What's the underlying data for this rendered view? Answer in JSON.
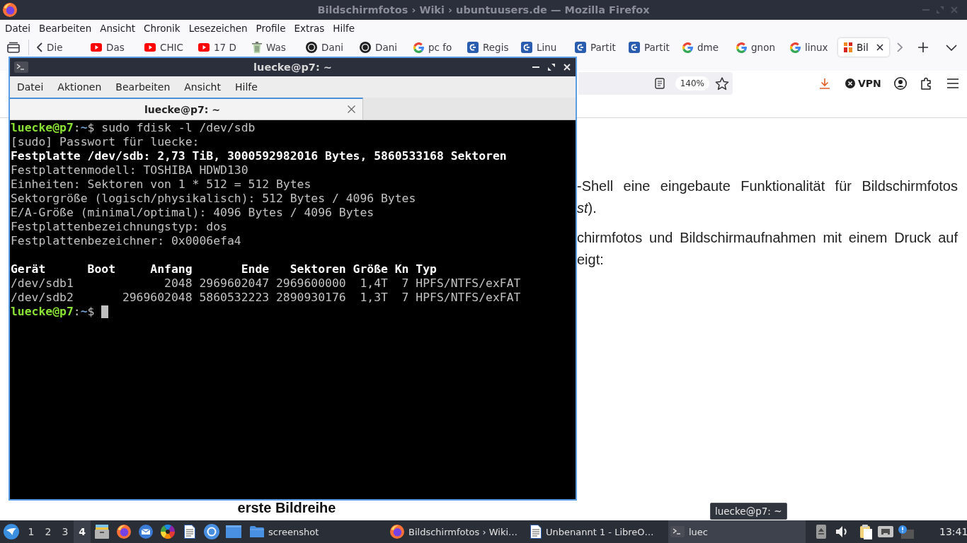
{
  "browser": {
    "title": "Bildschirmfotos › Wiki › ubuntuusers.de — Mozilla Firefox",
    "menu": [
      "Datei",
      "Bearbeiten",
      "Ansicht",
      "Chronik",
      "Lesezeichen",
      "Profile",
      "Extras",
      "Hilfe"
    ],
    "tabs": [
      {
        "label": "Die",
        "kind": "arrow",
        "selected": false
      },
      {
        "label": "Das",
        "kind": "video",
        "selected": false
      },
      {
        "label": "CHIC",
        "kind": "video",
        "selected": false
      },
      {
        "label": "17 D",
        "kind": "video",
        "selected": false
      },
      {
        "label": "Was",
        "kind": "bin",
        "selected": false
      },
      {
        "label": "Dani",
        "kind": "disc",
        "selected": false
      },
      {
        "label": "Dani",
        "kind": "disc",
        "selected": false
      },
      {
        "label": "pc fo",
        "kind": "search",
        "selected": false
      },
      {
        "label": "Regis",
        "kind": "tile",
        "selected": false
      },
      {
        "label": "Linu",
        "kind": "tile",
        "selected": false
      },
      {
        "label": "Partit",
        "kind": "tile",
        "selected": false
      },
      {
        "label": "Partit",
        "kind": "tile",
        "selected": false
      },
      {
        "label": "dme",
        "kind": "search",
        "selected": false
      },
      {
        "label": "gnon",
        "kind": "search",
        "selected": false
      },
      {
        "label": "linux",
        "kind": "search",
        "selected": false
      },
      {
        "label": "Bil",
        "kind": "logo",
        "selected": true
      }
    ],
    "zoom": "140%",
    "vpn": "VPN"
  },
  "page": {
    "paragraphs": [
      {
        "lines": [
          "-Shell eine eingebaute Funktionalität für Bildschirmfotos",
          "*st*)."
        ]
      },
      {
        "lines": [
          "chirmfotos und Bildschirmaufnahmen mit einem Druck auf",
          "eigt:"
        ]
      }
    ],
    "caption": "erste Bildreihe"
  },
  "terminal": {
    "title": "luecke@p7: ~",
    "menu": [
      "Datei",
      "Aktionen",
      "Bearbeiten",
      "Ansicht",
      "Hilfe"
    ],
    "tabs": [
      {
        "label": "luecke@p7: ~",
        "selected": true
      }
    ],
    "blocks": [
      {
        "lines": [
          {
            "segments": [
              {
                "text": "luecke@p7",
                "kind": "user"
              },
              {
                "text": ":",
                "kind": "plain"
              },
              {
                "text": "~",
                "kind": "path"
              },
              {
                "text": "$ sudo fdisk -l /dev/sdb",
                "kind": "plain"
              }
            ],
            "cursor": false
          },
          {
            "segments": [
              {
                "text": "[sudo] Passwort für luecke:",
                "kind": "plain"
              }
            ],
            "cursor": false
          },
          {
            "segments": [
              {
                "text": "Festplatte /dev/sdb: 2,73 TiB, 3000592982016 Bytes, 5860533168 Sektoren",
                "kind": "bold"
              }
            ],
            "cursor": false
          },
          {
            "segments": [
              {
                "text": "Festplattenmodell: TOSHIBA HDWD130",
                "kind": "plain"
              }
            ],
            "cursor": false
          },
          {
            "segments": [
              {
                "text": "Einheiten: Sektoren von 1 * 512 = 512 Bytes",
                "kind": "plain"
              }
            ],
            "cursor": false
          },
          {
            "segments": [
              {
                "text": "Sektorgröße (logisch/physikalisch): 512 Bytes / 4096 Bytes",
                "kind": "plain"
              }
            ],
            "cursor": false
          },
          {
            "segments": [
              {
                "text": "E/A-Größe (minimal/optimal): 4096 Bytes / 4096 Bytes",
                "kind": "plain"
              }
            ],
            "cursor": false
          },
          {
            "segments": [
              {
                "text": "Festplattenbezeichnungstyp: dos",
                "kind": "plain"
              }
            ],
            "cursor": false
          },
          {
            "segments": [
              {
                "text": "Festplattenbezeichner: 0x0006efa4",
                "kind": "plain"
              }
            ],
            "cursor": false
          }
        ]
      },
      {
        "lines": [
          {
            "segments": [
              {
                "text": "Gerät      Boot     Anfang       Ende   Sektoren Größe Kn Typ",
                "kind": "bold"
              }
            ],
            "cursor": false
          },
          {
            "segments": [
              {
                "text": "/dev/sdb1             2048 2969602047 2969600000  1,4T  7 HPFS/NTFS/exFAT",
                "kind": "plain"
              }
            ],
            "cursor": false
          },
          {
            "segments": [
              {
                "text": "/dev/sdb2       2969602048 5860532223 2890930176  1,3T  7 HPFS/NTFS/exFAT",
                "kind": "plain"
              }
            ],
            "cursor": false
          },
          {
            "segments": [
              {
                "text": "luecke@p7",
                "kind": "user"
              },
              {
                "text": ":",
                "kind": "plain"
              },
              {
                "text": "~",
                "kind": "path"
              },
              {
                "text": "$",
                "kind": "plain"
              }
            ],
            "cursor": true
          }
        ]
      }
    ]
  },
  "taskbar": {
    "workspaces": [
      {
        "label": "1",
        "selected": false
      },
      {
        "label": "2",
        "selected": false
      },
      {
        "label": "3",
        "selected": false
      },
      {
        "label": "4",
        "selected": true
      }
    ],
    "windows": [
      {
        "label": "screenshot",
        "kind": "folder",
        "selected": false
      },
      {
        "label": "Bildschirmfotos › Wiki…",
        "kind": "browser",
        "selected": false
      },
      {
        "label": "Unbenannt 1 - LibreO…",
        "kind": "document",
        "selected": false
      },
      {
        "label": "luec",
        "kind": "terminal",
        "selected": true
      }
    ],
    "tooltip": "luecke@p7: ~",
    "clock": "13:41"
  }
}
